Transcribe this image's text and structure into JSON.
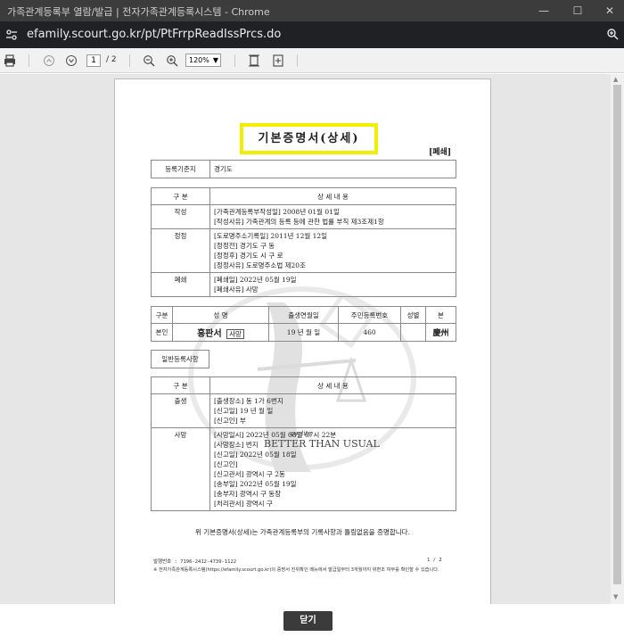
{
  "window": {
    "title": "가족관계등록부 열람/발급 | 전자가족관계등록시스템 - Chrome",
    "url": "efamily.scourt.go.kr/pt/PtFrrpReadIssPrcs.do"
  },
  "toolbar": {
    "page_current": "1",
    "page_total": "/ 2",
    "zoom": "120%"
  },
  "document": {
    "title": "기본증명서(상세)",
    "closed_tag": "[폐쇄]",
    "reg_base_label": "등록기준지",
    "reg_base_value": "경기도",
    "section_header": {
      "col1": "구 분",
      "col2": "상 세 내 용"
    },
    "sections": [
      {
        "label": "작성",
        "lines": [
          "[가족관계등록부작성일]    2008년 01월 01일",
          "[작성사유]   가족관계의 등록 등에 관한 법률 부칙 제3조제1항"
        ]
      },
      {
        "label": "정정",
        "lines": [
          "[도로명주소기록일]    2011년 12월 12일",
          "[정정전]   경기도                구        동",
          "[정정후]   경기도      시        구        로",
          "[정정사유]   도로명주소법 제20조"
        ]
      },
      {
        "label": "폐쇄",
        "lines": [
          "[폐쇄일]   2022년 05월 19일",
          "[폐쇄사유]   사망"
        ]
      }
    ],
    "person_header": {
      "kind": "구분",
      "name": "성    명",
      "birth": "출생연월일",
      "rrn": "주민등록번호",
      "sex": "성별",
      "origin": "본"
    },
    "person_row": {
      "kind": "본인",
      "name": "홍판서",
      "tag": "사망",
      "birth": "19    년    월    일",
      "rrn": "460",
      "origin": "慶州"
    },
    "general_label": "일반등록사항",
    "events_header": {
      "col1": "구 분",
      "col2": "상 세 내 용"
    },
    "events": [
      {
        "label": "출생",
        "lines": [
          "[출생장소]                동 1가 6번지",
          "[신고일]   19    년    월    일",
          "[신고인]   부"
        ]
      },
      {
        "label": "사망",
        "lines": [
          "[사망일시]   2022년 05월 08일 07시 22분",
          "[사망장소]                                 번지",
          "[신고일]   2022년 05월 18일",
          "[신고인]",
          "[신고관서]           광역시       구       2동",
          "[송부일]   2022년 05월 19일",
          "[송부자]          광역시        구          동장",
          "[처리관서]          광역시        구"
        ]
      }
    ],
    "certification": "위 기본증명서(상세)는 가족관계등록부의 기록사항과 틀림없음을 증명합니다.",
    "issue_number": "발행번호 : 7196-2412-4739-1122",
    "page_number": "1  /  2",
    "notice": "※ 전자가족관계등록시스템(https://efamily.scourt.go.kr)의 증명서 진위확인 메뉴에서 발급일부터 3개월까지 위변조 여부를 확인할 수 있습니다.",
    "watermark_text": "BETTER THAN USUAL",
    "watermark_script": "quality"
  },
  "bottom": {
    "close_label": "닫기"
  },
  "colors": {
    "highlight": "#f2ee00",
    "chrome_dark": "#202124",
    "button": "#3b3b3b"
  }
}
